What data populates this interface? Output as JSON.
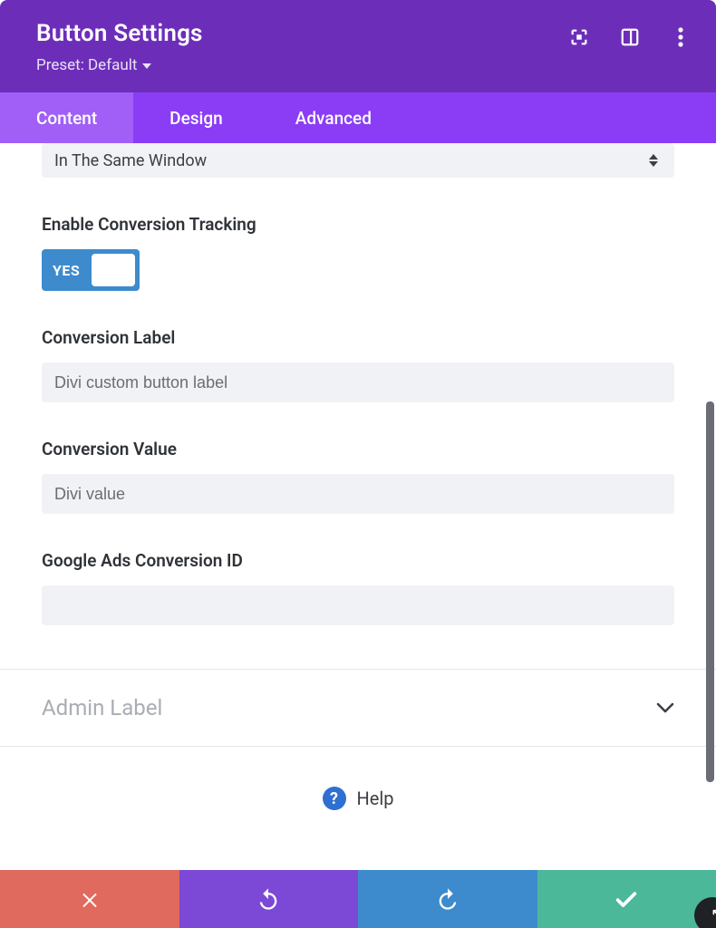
{
  "header": {
    "title": "Button Settings",
    "preset_label": "Preset: Default"
  },
  "tabs": {
    "content": "Content",
    "design": "Design",
    "advanced": "Advanced"
  },
  "form": {
    "link_target_value": "In The Same Window",
    "enable_tracking_label": "Enable Conversion Tracking",
    "toggle_text": "YES",
    "conversion_label_label": "Conversion Label",
    "conversion_label_value": "Divi custom button label",
    "conversion_value_label": "Conversion Value",
    "conversion_value_value": "Divi value",
    "google_ads_label": "Google Ads Conversion ID",
    "google_ads_value": ""
  },
  "section": {
    "admin_label": "Admin Label"
  },
  "help": {
    "text": "Help",
    "icon_char": "?"
  }
}
